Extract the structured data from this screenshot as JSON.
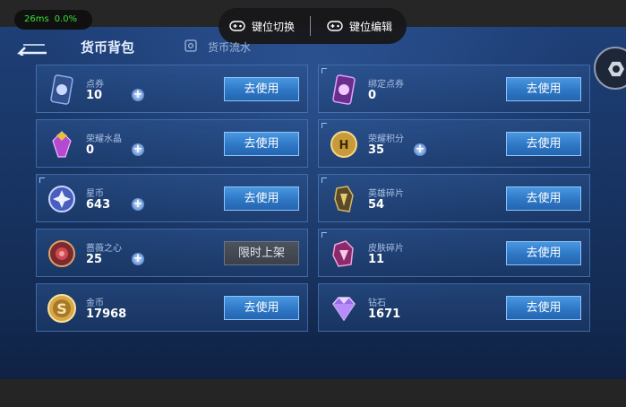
{
  "overlay": {
    "fps_ms": "26ms",
    "fps_pct": "0.0%",
    "key_switch_label": "键位切换",
    "key_edit_label": "键位编辑"
  },
  "header": {
    "title": "货币背包",
    "flow_label": "货币流水"
  },
  "currencies": [
    {
      "name": "点券",
      "value": "10",
      "plus": true,
      "action": "去使用",
      "icon": "voucher-icon",
      "color": "#4a6fb8"
    },
    {
      "name": "绑定点券",
      "value": "0",
      "plus": false,
      "action": "去使用",
      "icon": "bound-voucher-icon",
      "color": "#a05ac8"
    },
    {
      "name": "荣耀水晶",
      "value": "0",
      "plus": true,
      "action": "去使用",
      "icon": "glory-crystal-icon",
      "color": "#c04ad8"
    },
    {
      "name": "荣耀积分",
      "value": "35",
      "plus": true,
      "action": "去使用",
      "icon": "glory-points-icon",
      "color": "#d6a43c"
    },
    {
      "name": "星币",
      "value": "643",
      "plus": true,
      "action": "去使用",
      "icon": "star-coin-icon",
      "color": "#8aa8f0"
    },
    {
      "name": "英雄碎片",
      "value": "54",
      "plus": false,
      "action": "去使用",
      "icon": "hero-fragment-icon",
      "color": "#b8943c"
    },
    {
      "name": "蔷薇之心",
      "value": "25",
      "plus": true,
      "action": "限时上架",
      "disabled": true,
      "icon": "rose-heart-icon",
      "color": "#c0504a"
    },
    {
      "name": "皮肤碎片",
      "value": "11",
      "plus": false,
      "action": "去使用",
      "icon": "skin-fragment-icon",
      "color": "#d04a9a"
    },
    {
      "name": "金币",
      "value": "17968",
      "plus": false,
      "action": "去使用",
      "icon": "gold-coin-icon",
      "color": "#d8a845"
    },
    {
      "name": "钻石",
      "value": "1671",
      "plus": false,
      "action": "去使用",
      "icon": "diamond-icon",
      "color": "#a878f0"
    }
  ]
}
